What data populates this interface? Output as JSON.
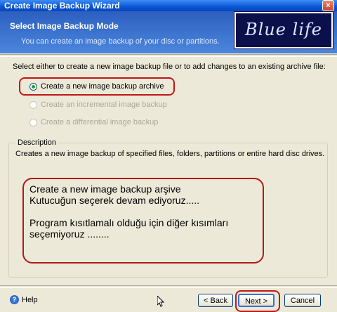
{
  "window": {
    "title": "Create Image Backup Wizard",
    "close_label": "×"
  },
  "header": {
    "title": "Select Image Backup Mode",
    "subtitle": "You can create an image backup of your disc or partitions.",
    "logo_text": "Blue life"
  },
  "instruction": "Select either to create a new image backup file or to add changes to an existing archive file:",
  "options": [
    {
      "label": "Create a new image backup archive",
      "checked": true,
      "enabled": true
    },
    {
      "label": "Create an incremental image backup",
      "checked": false,
      "enabled": false
    },
    {
      "label": "Create a differential image backup",
      "checked": false,
      "enabled": false
    }
  ],
  "description": {
    "legend": "Description",
    "text": "Creates a new image backup of specified files, folders, partitions or entire hard disc drives."
  },
  "note": {
    "line1": "Create a new image backup arşive",
    "line2": "Kutucuğun seçerek devam ediyoruz.....",
    "line3": "Program kısıtlamalı olduğu için diğer kısımları",
    "line4": "seçemiyoruz ........"
  },
  "footer": {
    "help_label": "Help",
    "help_icon": "?",
    "back_label": "< Back",
    "next_label": "Next >",
    "cancel_label": "Cancel"
  },
  "colors": {
    "header_bg": "#2c5fc0",
    "highlight_red": "#c01818",
    "radio_dot": "#21a121"
  }
}
